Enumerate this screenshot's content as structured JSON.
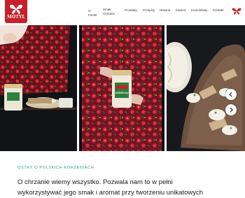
{
  "brand": {
    "logo_text": "MOTYL"
  },
  "nav": {
    "items": [
      {
        "id": "o-firmie",
        "lines": [
          "O",
          "Firmie"
        ]
      },
      {
        "id": "smak-chrzanu",
        "lines": [
          "Smak",
          "Chrzanu"
        ]
      },
      {
        "id": "produkty",
        "lines": [
          "Produkty"
        ]
      },
      {
        "id": "przepisy",
        "lines": [
          "Przepisy"
        ]
      },
      {
        "id": "historia",
        "lines": [
          "Historia"
        ]
      },
      {
        "id": "kariera",
        "lines": [
          "Kariera"
        ]
      },
      {
        "id": "komunikaty",
        "lines": [
          "Komunikaty"
        ]
      },
      {
        "id": "kontakt",
        "lines": [
          "Kontakt"
        ]
      }
    ]
  },
  "hero": {
    "jar_label": "Sałatkowy",
    "prev_icon": "chevron-left-icon",
    "next_icon": "chevron-right-icon"
  },
  "intro": {
    "kicker": "OSTRY O POLSKICH KORZENIACH",
    "heading_line1": "O chrzanie wiemy wszystko. Pozwala nam to w pełni",
    "heading_line2": "wykorzystywać jego smak i aromat przy tworzeniu unikatowych"
  },
  "colors": {
    "brand_red": "#c8202a",
    "accent_teal": "#2aa08a"
  }
}
